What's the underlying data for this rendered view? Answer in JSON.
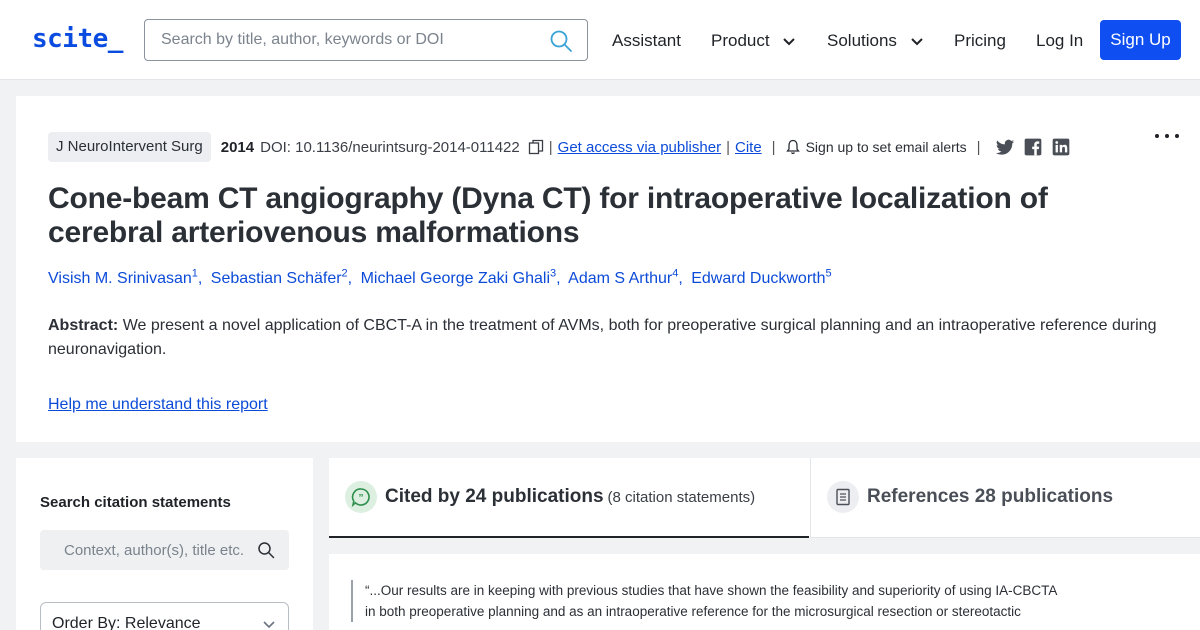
{
  "header": {
    "logo": "scite_",
    "search_placeholder": "Search by title, author, keywords or DOI",
    "nav": {
      "assistant": "Assistant",
      "product": "Product",
      "solutions": "Solutions",
      "pricing": "Pricing",
      "login": "Log In",
      "signup": "Sign Up"
    },
    "accent_color": "#0f4ff2"
  },
  "paper": {
    "journal": "J NeuroIntervent Surg",
    "year": "2014",
    "doi": "DOI: 10.1136/neurintsurg-2014-011422",
    "get_access": "Get access via publisher",
    "cite": "Cite",
    "alerts": "Sign up to set email alerts",
    "separator": "|",
    "title": "Cone-beam CT angiography (Dyna CT) for intraoperative localization of cerebral arteriovenous malformations",
    "authors": [
      {
        "name": "Visish M. Srinivasan",
        "sup": "1"
      },
      {
        "name": "Sebastian Schäfer",
        "sup": "2"
      },
      {
        "name": "Michael George Zaki Ghali",
        "sup": "3"
      },
      {
        "name": "Adam S Arthur",
        "sup": "4"
      },
      {
        "name": "Edward Duckworth",
        "sup": "5"
      }
    ],
    "abstract_label": "Abstract:",
    "abstract_text": "We present a novel application of CBCT-A in the treatment of AVMs, both for preoperative surgical planning and an intraoperative reference during neuronavigation.",
    "help_link": "Help me understand this report"
  },
  "sidebar": {
    "title": "Search citation statements",
    "search_placeholder": "Context, author(s), title etc.",
    "order_by": "Order By: Relevance"
  },
  "tabs": {
    "cited_label": "Cited by 24 publications",
    "cited_sub": "(8 citation statements)",
    "refs_label": "References 28 publications"
  },
  "citation": {
    "quote_line1": "“...Our results are in keeping with previous studies that have shown the feasibility and superiority of using IA-CBCTA",
    "quote_line2": "in both preoperative planning and as an intraoperative reference for the microsurgical resection or stereotactic"
  }
}
